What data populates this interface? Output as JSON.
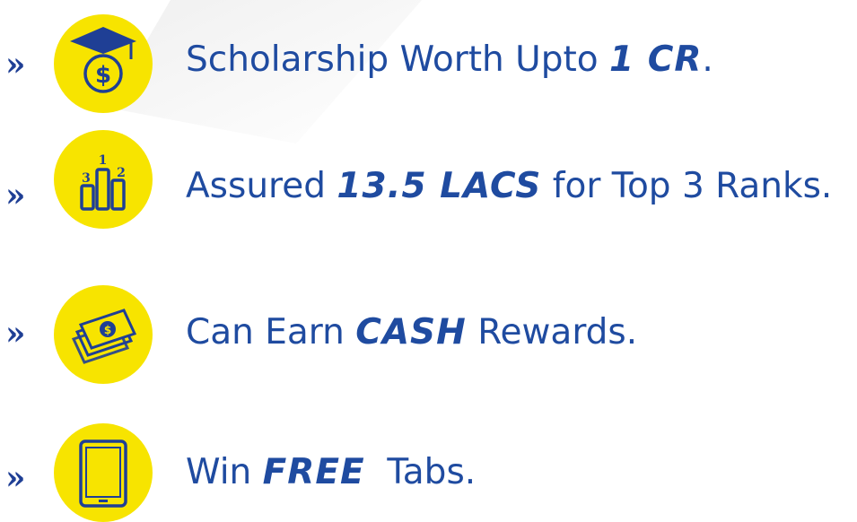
{
  "items": [
    {
      "icon": "graduation-dollar-icon",
      "prefix": "Scholarship Worth Upto ",
      "highlight": "1 CR",
      "suffix": "."
    },
    {
      "icon": "podium-ranks-icon",
      "prefix": "Assured ",
      "highlight": "13.5 LACS",
      "suffix": " for Top 3 Ranks."
    },
    {
      "icon": "cash-bills-icon",
      "prefix": "Can Earn ",
      "highlight": "CASH",
      "suffix": " Rewards."
    },
    {
      "icon": "tablet-icon",
      "prefix": "Win ",
      "highlight": "FREE",
      "suffix": "  Tabs."
    }
  ],
  "podium_labels": [
    "1",
    "2",
    "3"
  ],
  "bullet": "»",
  "colors": {
    "text": "#1f4ba0",
    "icon_bg": "#f7e400",
    "icon_line": "#1f3f95"
  }
}
